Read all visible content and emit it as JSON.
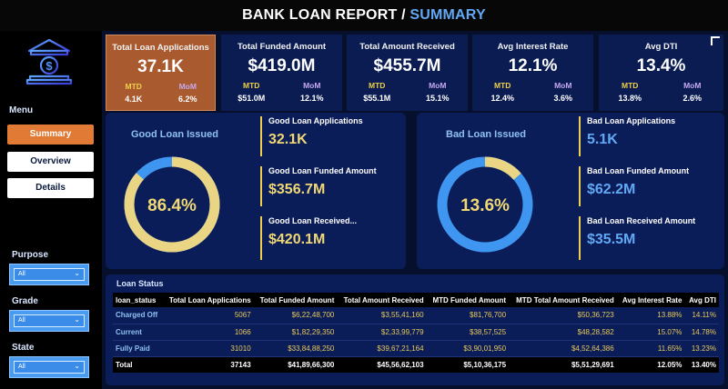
{
  "header": {
    "title_main": "BANK LOAN REPORT / ",
    "title_accent": "SUMMARY"
  },
  "colors": {
    "accent_orange": "#e07a35",
    "accent_blue": "#61a8f5",
    "good_ring": "#e9d583",
    "bad_ring": "#3f96f0",
    "background": "#06102c"
  },
  "sidebar": {
    "logo_icon": "bank-dollar-icon",
    "menu_label": "Menu",
    "nav": [
      "Summary",
      "Overview",
      "Details"
    ],
    "filters": [
      {
        "label": "Purpose",
        "value": "All"
      },
      {
        "label": "Grade",
        "value": "All"
      },
      {
        "label": "State",
        "value": "All"
      }
    ]
  },
  "kpis": [
    {
      "title": "Total Loan Applications",
      "value": "37.1K",
      "mtd_label": "MTD",
      "mom_label": "MoM",
      "mtd": "4.1K",
      "mom": "6.2%"
    },
    {
      "title": "Total Funded Amount",
      "value": "$419.0M",
      "mtd_label": "MTD",
      "mom_label": "MoM",
      "mtd": "$51.0M",
      "mom": "12.1%"
    },
    {
      "title": "Total Amount Received",
      "value": "$455.7M",
      "mtd_label": "MTD",
      "mom_label": "MoM",
      "mtd": "$55.1M",
      "mom": "15.1%"
    },
    {
      "title": "Avg Interest Rate",
      "value": "12.1%",
      "mtd_label": "MTD",
      "mom_label": "MoM",
      "mtd": "12.4%",
      "mom": "3.6%"
    },
    {
      "title": "Avg DTI",
      "value": "13.4%",
      "mtd_label": "MTD",
      "mom_label": "MoM",
      "mtd": "13.8%",
      "mom": "2.6%"
    }
  ],
  "good_loan": {
    "title": "Good Loan Issued",
    "percent_label": "86.4%",
    "percent": 86.4,
    "metrics": [
      {
        "label": "Good Loan Applications",
        "value": "32.1K"
      },
      {
        "label": "Good Loan Funded Amount",
        "value": "$356.7M"
      },
      {
        "label": "Good Loan Received...",
        "value": "$420.1M"
      }
    ]
  },
  "bad_loan": {
    "title": "Bad Loan Issued",
    "percent_label": "13.6%",
    "percent": 13.6,
    "metrics": [
      {
        "label": "Bad Loan Applications",
        "value": "5.1K"
      },
      {
        "label": "Bad Loan Funded Amount",
        "value": "$62.2M"
      },
      {
        "label": "Bad Loan Received Amount",
        "value": "$35.5M"
      }
    ]
  },
  "loan_status": {
    "title": "Loan Status",
    "columns": [
      "loan_status",
      "Total Loan Applications",
      "Total Funded Amount",
      "Total Amount Received",
      "MTD Funded Amount",
      "MTD Total Amount Received",
      "Avg Interest Rate",
      "Avg DTI"
    ],
    "rows": [
      [
        "Charged Off",
        "5067",
        "$6,22,48,700",
        "$3,55,41,160",
        "$81,76,700",
        "$50,36,723",
        "13.88%",
        "14.11%"
      ],
      [
        "Current",
        "1066",
        "$1,82,29,350",
        "$2,33,99,779",
        "$38,57,525",
        "$48,28,582",
        "15.07%",
        "14.78%"
      ],
      [
        "Fully Paid",
        "31010",
        "$33,84,88,250",
        "$39,67,21,164",
        "$3,90,01,950",
        "$4,52,64,386",
        "11.65%",
        "13.23%"
      ],
      [
        "Total",
        "37143",
        "$41,89,66,300",
        "$45,56,62,103",
        "$5,10,36,175",
        "$5,51,29,691",
        "12.05%",
        "13.40%"
      ]
    ]
  }
}
